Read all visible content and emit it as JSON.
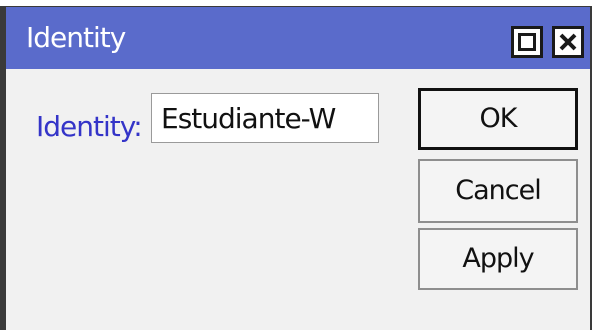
{
  "window": {
    "title": "Identity"
  },
  "titlebar": {
    "buttons": [
      {
        "icon": "maximize-icon"
      },
      {
        "icon": "close-icon"
      }
    ]
  },
  "form": {
    "identity_label": "Identity:",
    "identity_value": "Estudiante-W"
  },
  "actions": {
    "ok_label": "OK",
    "cancel_label": "Cancel",
    "apply_label": "Apply"
  },
  "colors": {
    "titlebar": "#5a6bcb",
    "label_text": "#3434c8",
    "background": "#f1f1f1"
  }
}
